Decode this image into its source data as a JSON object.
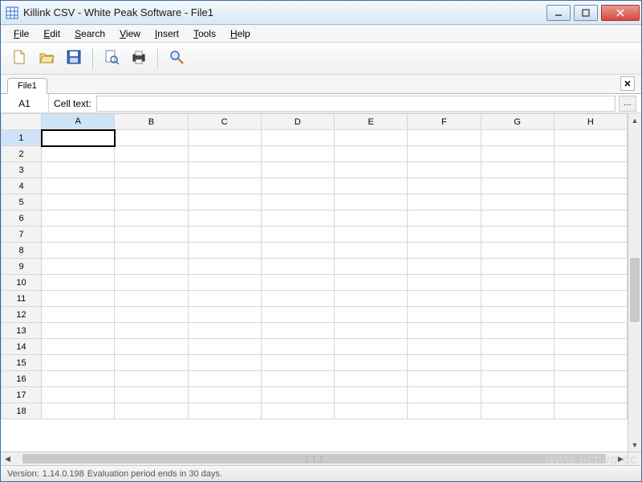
{
  "window": {
    "title": "Killink CSV - White Peak Software - File1"
  },
  "menubar": {
    "items": [
      {
        "label": "File",
        "accel": "F"
      },
      {
        "label": "Edit",
        "accel": "E"
      },
      {
        "label": "Search",
        "accel": "S"
      },
      {
        "label": "View",
        "accel": "V"
      },
      {
        "label": "Insert",
        "accel": "I"
      },
      {
        "label": "Tools",
        "accel": "T"
      },
      {
        "label": "Help",
        "accel": "H"
      }
    ]
  },
  "toolbar": {
    "buttons": [
      {
        "name": "new-file",
        "icon": "new"
      },
      {
        "name": "open-file",
        "icon": "open"
      },
      {
        "name": "save-file",
        "icon": "save"
      }
    ],
    "buttons2": [
      {
        "name": "print-preview",
        "icon": "preview"
      },
      {
        "name": "print",
        "icon": "print"
      }
    ],
    "buttons3": [
      {
        "name": "find",
        "icon": "find"
      }
    ]
  },
  "tabs": {
    "items": [
      "File1"
    ],
    "active": 0
  },
  "cellref": {
    "address": "A1",
    "label": "Cell text:",
    "value": ""
  },
  "grid": {
    "columns": [
      "A",
      "B",
      "C",
      "D",
      "E",
      "F",
      "G",
      "H"
    ],
    "rows": [
      1,
      2,
      3,
      4,
      5,
      6,
      7,
      8,
      9,
      10,
      11,
      12,
      13,
      14,
      15,
      16,
      17,
      18
    ],
    "active_col": "A",
    "active_row": 1
  },
  "statusbar": {
    "version_label": "Version:",
    "version": "1.14.0.198",
    "trial": "Evaluation period ends in 30 days."
  },
  "watermark": "www.ucbug.cc"
}
